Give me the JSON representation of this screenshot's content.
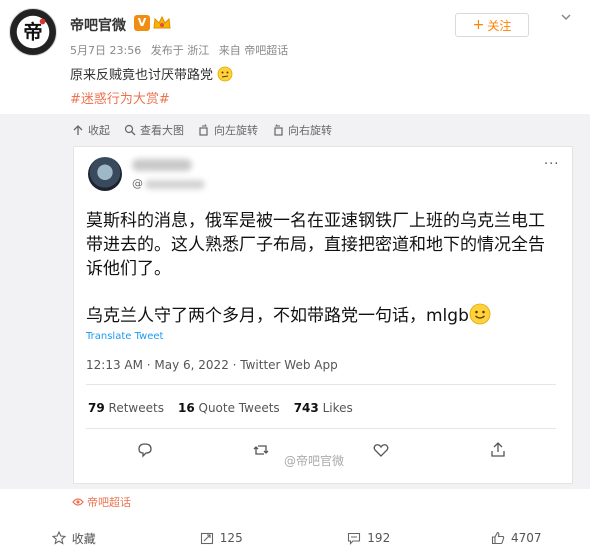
{
  "post": {
    "author": "帝吧官微",
    "v_badge": "V",
    "date": "5月7日 23:56",
    "published_from": "发布于 浙江",
    "via": "来自 帝吧超话",
    "follow_label": "关注",
    "text": "原来反贼竟也讨厌带路党",
    "hashtag": "#迷惑行为大赏#"
  },
  "image_tools": [
    {
      "label": "收起",
      "icon": "collapse-icon"
    },
    {
      "label": "查看大图",
      "icon": "zoom-icon"
    },
    {
      "label": "向左旋转",
      "icon": "rotate-left-icon"
    },
    {
      "label": "向右旋转",
      "icon": "rotate-right-icon"
    }
  ],
  "tweet": {
    "handle_prefix": "@",
    "line1": "莫斯科的消息，俄军是被一名在亚速钢铁厂上班的乌克兰电工带进去的。这人熟悉厂子布局，直接把密道和地下的情况全告诉他们了。",
    "line2": "乌克兰人守了两个多月，不如带路党一句话，mlgb",
    "translate": "Translate Tweet",
    "timestamp": "12:13 AM · May 6, 2022 · Twitter Web App",
    "retweets_count": "79",
    "retweets_label": "Retweets",
    "quotes_count": "16",
    "quotes_label": "Quote Tweets",
    "likes_count": "743",
    "likes_label": "Likes",
    "watermark": "@帝吧官微"
  },
  "source_label": "帝吧超话",
  "footer": {
    "favorite": "收藏",
    "repost": "125",
    "comment": "192",
    "like": "4707"
  },
  "colors": {
    "accent_orange": "#ff8200",
    "hashtag": "#eb7350",
    "twitter_blue": "#1d9bf0",
    "panel_bg": "#f2f2f5"
  }
}
